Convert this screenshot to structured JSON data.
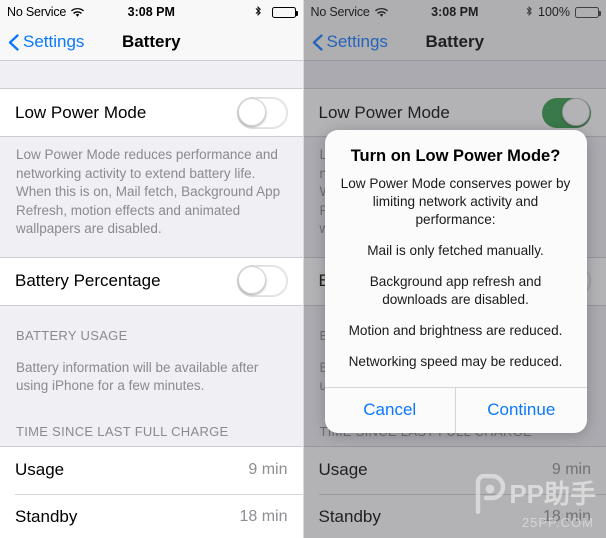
{
  "left": {
    "statusbar": {
      "carrier": "No Service",
      "wifi_icon": "wifi-icon",
      "time": "3:08 PM",
      "bluetooth_icon": "bluetooth-icon",
      "battery_percent": "",
      "battery_icon": "battery-full-icon"
    },
    "navbar": {
      "back_label": "Settings",
      "back_icon": "chevron-left-icon",
      "title": "Battery"
    },
    "low_power": {
      "label": "Low Power Mode",
      "toggle_state": "off",
      "note": "Low Power Mode reduces performance and networking activity to extend battery life.  When this is on, Mail fetch, Background App Refresh, motion effects and animated wallpapers are disabled."
    },
    "battery_percentage": {
      "label": "Battery Percentage",
      "toggle_state": "off"
    },
    "battery_usage": {
      "header": "BATTERY USAGE",
      "note": "Battery information will be available after using iPhone for a few minutes."
    },
    "time_since": {
      "header": "TIME SINCE LAST FULL CHARGE",
      "rows": [
        {
          "label": "Usage",
          "value": "9 min"
        },
        {
          "label": "Standby",
          "value": "18 min"
        }
      ]
    }
  },
  "right": {
    "statusbar": {
      "carrier": "No Service",
      "wifi_icon": "wifi-icon",
      "time": "3:08 PM",
      "bluetooth_icon": "bluetooth-icon",
      "battery_percent": "100%",
      "battery_icon": "battery-low-power-icon"
    },
    "navbar": {
      "back_label": "Settings",
      "back_icon": "chevron-left-icon",
      "title": "Battery"
    },
    "low_power": {
      "label": "Low Power Mode",
      "toggle_state": "on",
      "note": "Low Power Mode reduces performance and networking activity to extend battery life.  When this is on, Mail fetch, Background App Refresh, motion effects and animated wallpapers are disabled."
    },
    "battery_percentage": {
      "label": "Battery Percentage",
      "toggle_state": "off"
    },
    "battery_usage": {
      "header": "BATTERY USAGE",
      "note": "Battery information will be available after using iPhone for a few minutes."
    },
    "time_since": {
      "header": "TIME SINCE LAST FULL CHARGE",
      "rows": [
        {
          "label": "Usage",
          "value": "9 min"
        },
        {
          "label": "Standby",
          "value": "18 min"
        }
      ]
    },
    "dialog": {
      "title": "Turn on Low Power Mode?",
      "paragraphs": [
        "Low Power Mode conserves power by limiting network activity and performance:",
        "Mail is only fetched manually.",
        "Background app refresh and downloads are disabled.",
        "Motion and brightness are reduced.",
        "Networking speed may be reduced."
      ],
      "cancel_label": "Cancel",
      "continue_label": "Continue"
    }
  },
  "watermark": {
    "logo_icon": "pp-logo-icon",
    "text": "PP助手",
    "sub": "25PP.COM"
  },
  "colors": {
    "accent_blue": "#0a78ff",
    "toggle_green": "#2e9b45",
    "battery_yellow": "#e8b514",
    "group_bg": "#efeff4",
    "secondary_text": "#8a8a8f"
  }
}
